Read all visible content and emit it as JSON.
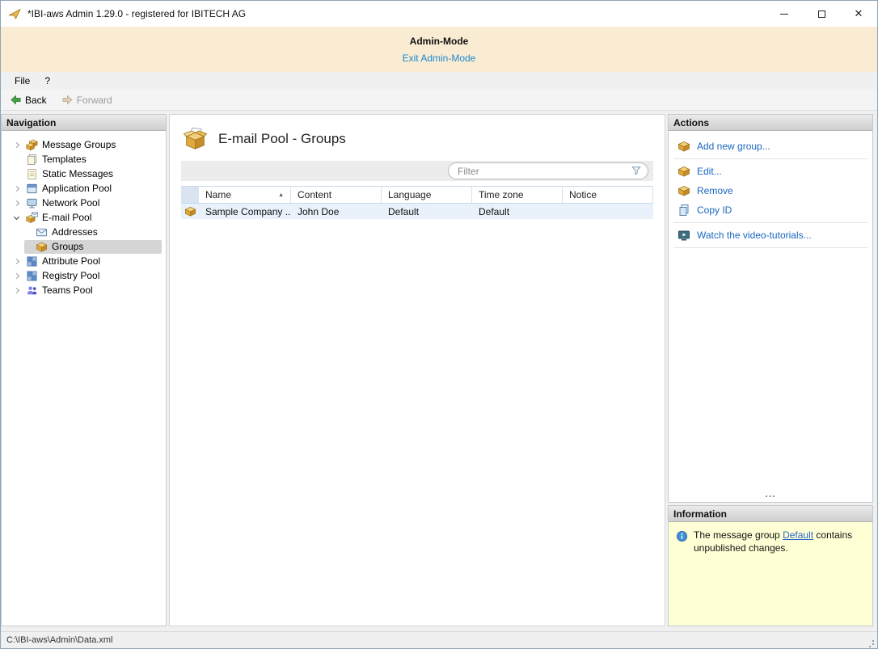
{
  "window": {
    "title": "*IBI-aws Admin 1.29.0 - registered for IBITECH AG"
  },
  "admin_banner": {
    "title": "Admin-Mode",
    "exit_link": "Exit Admin-Mode"
  },
  "menu": {
    "items": [
      {
        "label": "File"
      },
      {
        "label": "?"
      }
    ]
  },
  "toolbar": {
    "back_label": "Back",
    "forward_label": "Forward"
  },
  "navigation": {
    "header": "Navigation",
    "items": [
      {
        "label": "Message Groups",
        "icon": "message-groups-icon",
        "state": "collapsed"
      },
      {
        "label": "Templates",
        "icon": "templates-icon",
        "state": "leaf"
      },
      {
        "label": "Static Messages",
        "icon": "static-messages-icon",
        "state": "leaf"
      },
      {
        "label": "Application Pool",
        "icon": "application-pool-icon",
        "state": "collapsed"
      },
      {
        "label": "Network Pool",
        "icon": "network-pool-icon",
        "state": "collapsed"
      },
      {
        "label": "E-mail Pool",
        "icon": "email-pool-icon",
        "state": "expanded"
      },
      {
        "label": "Addresses",
        "icon": "addresses-icon",
        "state": "child"
      },
      {
        "label": "Groups",
        "icon": "groups-icon",
        "state": "child",
        "selected": true
      },
      {
        "label": "Attribute Pool",
        "icon": "attribute-pool-icon",
        "state": "collapsed"
      },
      {
        "label": "Registry Pool",
        "icon": "registry-pool-icon",
        "state": "collapsed"
      },
      {
        "label": "Teams Pool",
        "icon": "teams-pool-icon",
        "state": "collapsed"
      }
    ]
  },
  "main": {
    "title": "E-mail Pool - Groups",
    "filter_placeholder": "Filter",
    "table": {
      "columns": [
        "Name",
        "Content",
        "Language",
        "Time zone",
        "Notice"
      ],
      "sort_icon": "▲",
      "rows": [
        {
          "name": "Sample Company ...",
          "content": "John Doe",
          "language": "Default",
          "time_zone": "Default",
          "notice": ""
        }
      ]
    }
  },
  "actions": {
    "header": "Actions",
    "items": [
      {
        "label": "Add new group...",
        "icon": "add-group-icon"
      },
      {
        "label": "Edit...",
        "icon": "edit-icon"
      },
      {
        "label": "Remove",
        "icon": "remove-icon"
      },
      {
        "label": "Copy ID",
        "icon": "copy-id-icon"
      },
      {
        "label": "Watch the video-tutorials...",
        "icon": "video-tutorials-icon"
      }
    ],
    "overflow": "..."
  },
  "information": {
    "header": "Information",
    "text_prefix": "The message group ",
    "link_text": "Default",
    "text_suffix": " contains unpublished changes."
  },
  "statusbar": {
    "path": "C:\\IBI-aws\\Admin\\Data.xml"
  }
}
